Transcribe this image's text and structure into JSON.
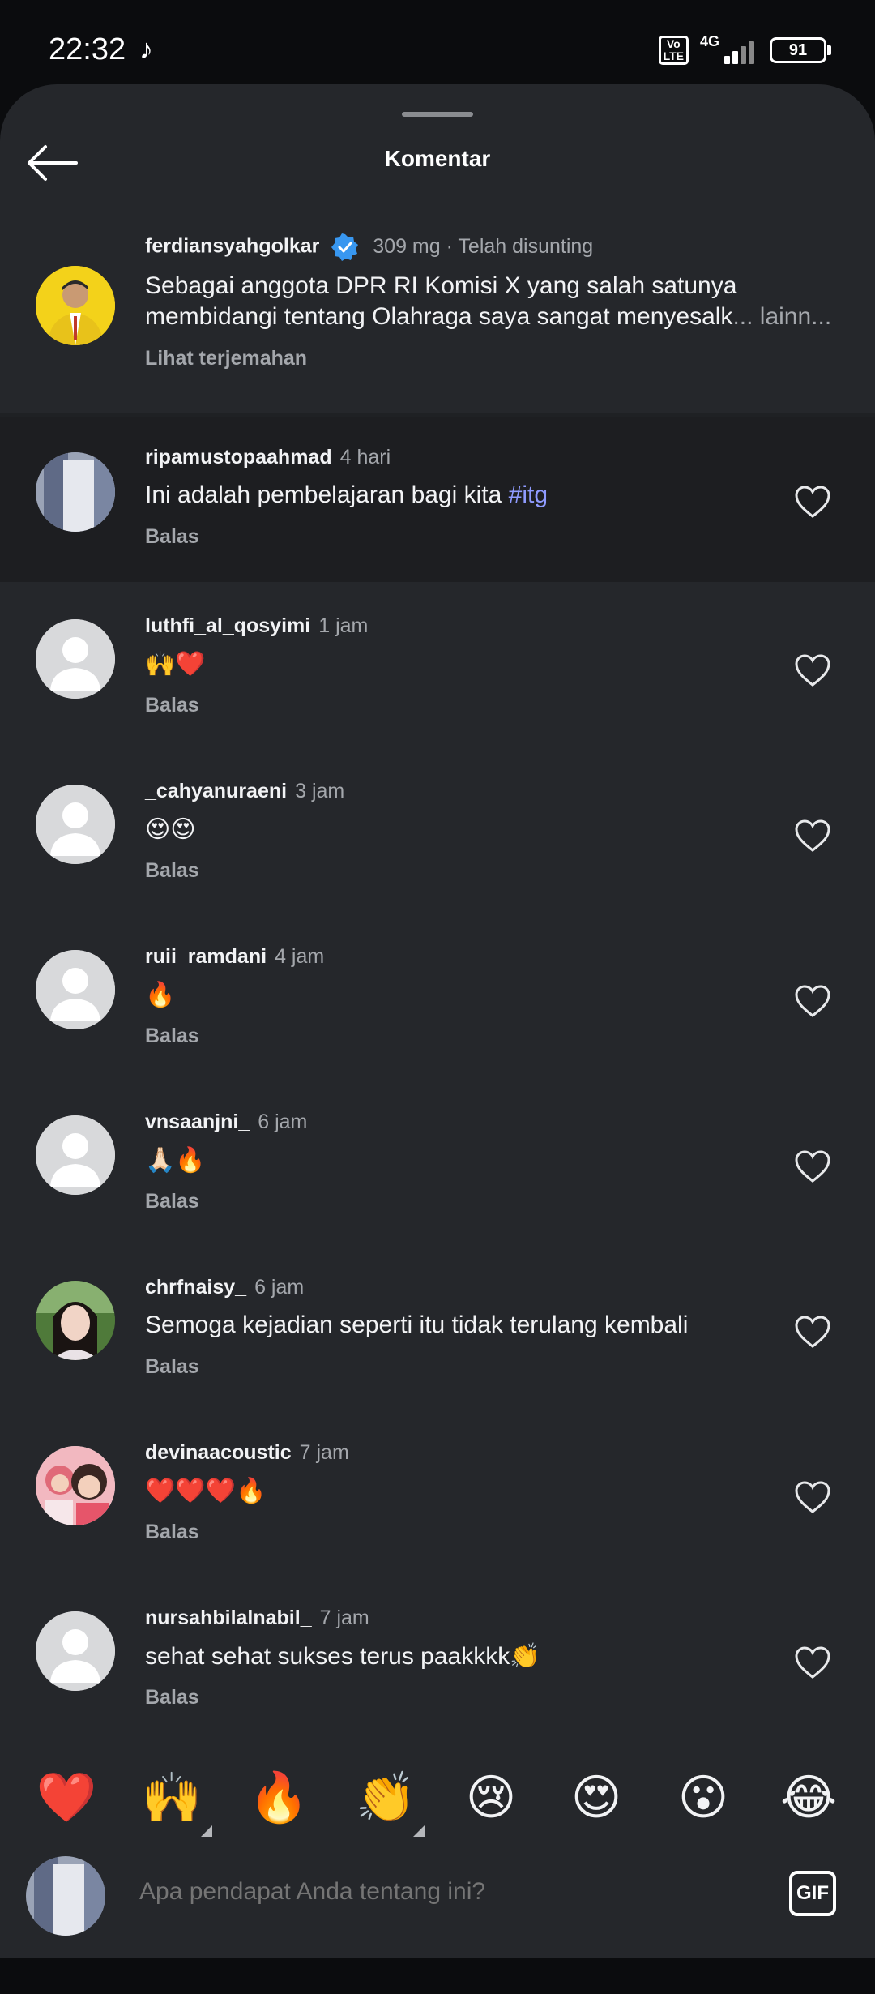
{
  "status_bar": {
    "time": "22:32",
    "volte": "Vo\nLTE",
    "network": "4G",
    "battery": "91"
  },
  "header": {
    "title": "Komentar"
  },
  "caption": {
    "username": "ferdiansyahgolkar",
    "meta": "309 mg · Telah disunting",
    "text_line1": "Sebagai anggota DPR RI Komisi X yang salah satunya",
    "text_line2": "membidangi tentang Olahraga saya sangat menyesalk",
    "more": "... lainn...",
    "translate": "Lihat terjemahan"
  },
  "comments": [
    {
      "username": "ripamustopaahmad",
      "time": "4 hari",
      "text": "Ini adalah pembelajaran bagi kita ",
      "hashtag": "#itg",
      "reply": "Balas"
    },
    {
      "username": "luthfi_al_qosyimi",
      "time": "1 jam",
      "text": "🙌❤️",
      "reply": "Balas"
    },
    {
      "username": "_cahyanuraeni",
      "time": "3 jam",
      "text": "😍😍",
      "reply": "Balas"
    },
    {
      "username": "ruii_ramdani",
      "time": "4 jam",
      "text": "🔥",
      "reply": "Balas"
    },
    {
      "username": "vnsaanjni_",
      "time": "6 jam",
      "text": "🙏🏻🔥",
      "reply": "Balas"
    },
    {
      "username": "chrfnaisy_",
      "time": "6 jam",
      "text": "Semoga kejadian seperti itu tidak terulang kembali",
      "reply": "Balas"
    },
    {
      "username": "devinaacoustic",
      "time": "7 jam",
      "text": "❤️❤️❤️🔥",
      "reply": "Balas"
    },
    {
      "username": "nursahbilalnabil_",
      "time": "7 jam",
      "text": "sehat sehat sukses terus paakkkk👏",
      "reply": "Balas"
    }
  ],
  "reactions": [
    "❤️",
    "🙌",
    "🔥",
    "👏",
    "😢",
    "😍",
    "😮",
    "😂"
  ],
  "composer": {
    "placeholder": "Apa pendapat Anda tentang ini?",
    "gif_label": "GIF"
  }
}
